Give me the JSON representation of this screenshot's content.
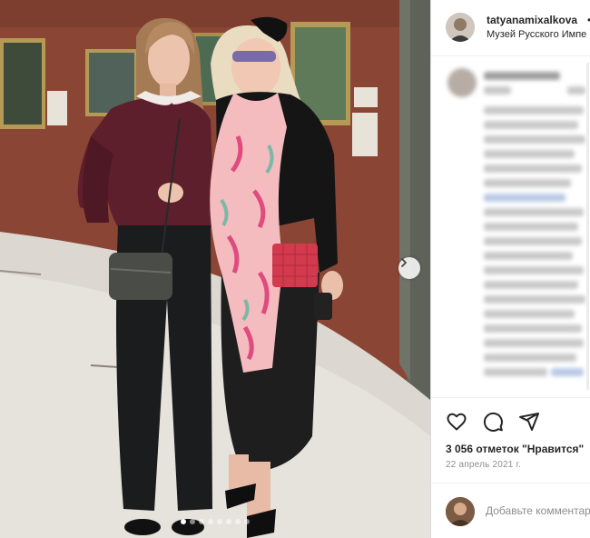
{
  "post": {
    "username": "tatyanamixalkova",
    "follow_separator": "•",
    "location": "Музей Русского Импе"
  },
  "photo": {
    "slide_count": 8,
    "active_slide": 1,
    "next_icon": "chevron-right-icon"
  },
  "actions": {
    "like_icon": "heart-icon",
    "comment_icon": "comment-icon",
    "share_icon": "share-icon",
    "likes_text": "3 056 отметок \"Нравится\"",
    "date_text": "22 апрель 2021 г."
  },
  "comment_box": {
    "placeholder": "Добавьте комментарий..."
  },
  "colors": {
    "wall": "#8b4636",
    "floor": "#d9d6cf",
    "accent_text": "#262626",
    "muted_text": "#8e8e8e"
  }
}
